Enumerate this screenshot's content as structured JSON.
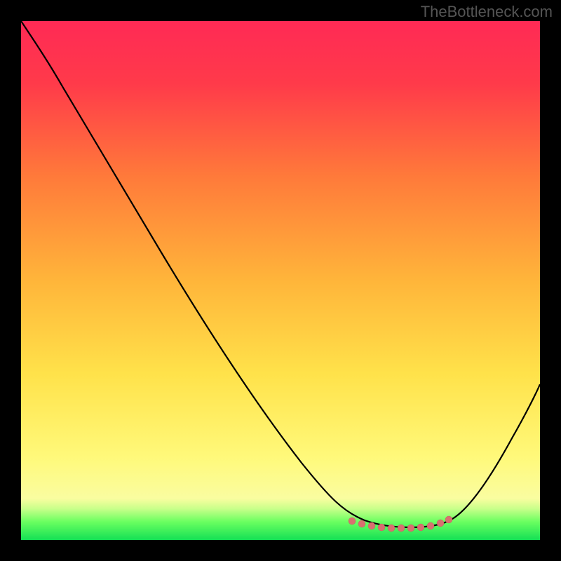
{
  "watermark": "TheBottleneck.com",
  "chart_data": {
    "type": "line",
    "title": "",
    "xlabel": "",
    "ylabel": "",
    "xlim": [
      0,
      100
    ],
    "ylim": [
      0,
      100
    ],
    "grid": false,
    "series": [
      {
        "name": "bottleneck-curve",
        "x": [
          0,
          5,
          10,
          15,
          20,
          25,
          30,
          35,
          40,
          45,
          50,
          55,
          60,
          62,
          65,
          68,
          72,
          76,
          80,
          82,
          85,
          90,
          95,
          100
        ],
        "y": [
          100,
          96,
          90,
          82,
          74,
          66,
          58,
          50,
          42,
          34,
          27,
          20,
          13,
          9,
          5,
          3,
          2,
          2,
          2,
          3,
          6,
          13,
          21,
          30
        ],
        "color": "#000000"
      }
    ],
    "markers": {
      "name": "flat-region-dots",
      "x": [
        64,
        66,
        68,
        70,
        72,
        74,
        76,
        78,
        80,
        82
      ],
      "y": [
        4,
        3,
        2.5,
        2,
        2,
        2,
        2,
        2.5,
        3,
        4
      ],
      "color": "#d97070"
    },
    "background_gradient": {
      "top": "#ff2a4a",
      "mid_upper": "#ff7a3a",
      "mid": "#ffd23a",
      "mid_lower": "#fff86a",
      "bottom_band": "#7fff6a",
      "bottom_edge": "#14e055"
    }
  }
}
